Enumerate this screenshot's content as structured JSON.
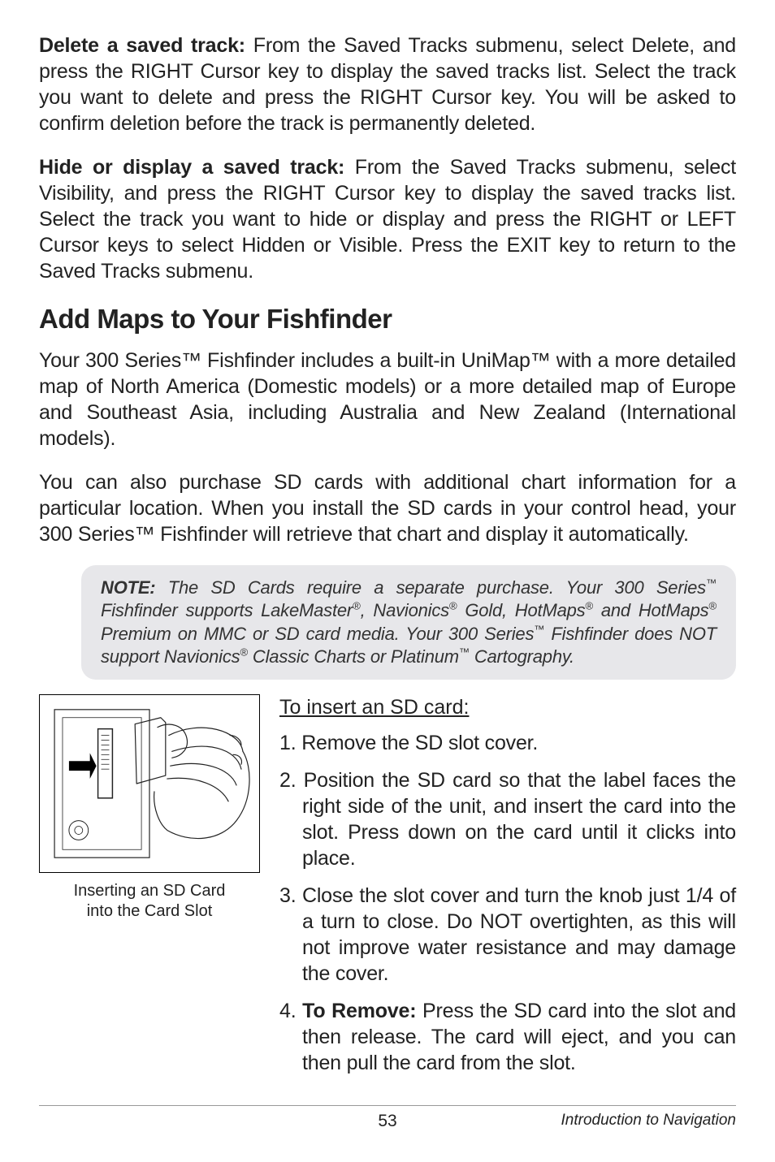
{
  "para1_label": "Delete a saved track:",
  "para1_text": " From the Saved Tracks submenu, select Delete, and press the RIGHT Cursor key to display the saved tracks list. Select the track you want to delete and press the RIGHT Cursor key. You will be asked to confirm deletion before the track is permanently deleted.",
  "para2_label": "Hide or display a saved track:",
  "para2_text": " From the Saved Tracks submenu, select Visibility, and press the RIGHT Cursor key to display the saved tracks list. Select the track you want to hide or display and press the RIGHT or LEFT Cursor keys to select Hidden or Visible. Press the EXIT key to return to the Saved Tracks submenu.",
  "heading": "Add Maps to Your Fishfinder",
  "para3": "Your 300 Series™ Fishfinder includes a built-in UniMap™ with a more detailed map of North America (Domestic models) or a more detailed map of Europe and Southeast Asia, including Australia and New Zealand (International models).",
  "para4": "You can also purchase SD cards with additional chart information for a particular location. When you install the SD cards in your control head, your 300 Series™ Fishfinder will retrieve that chart and display it automatically.",
  "note_label": "NOTE:",
  "note_text_1": " The SD Cards require a separate purchase. Your 300 Series",
  "note_sup_1": "™",
  "note_text_2": " Fishfinder supports LakeMaster",
  "note_sup_2": "®",
  "note_text_3": ", Navionics",
  "note_sup_3": "®",
  "note_text_4": " Gold, HotMaps",
  "note_sup_4": "®",
  "note_text_5": " and HotMaps",
  "note_sup_5": "®",
  "note_text_6": " Premium on MMC or SD card media. Your 300 Series",
  "note_sup_6": "™",
  "note_text_7": " Fishfinder does NOT support Navionics",
  "note_sup_7": "®",
  "note_text_8": " Classic Charts or Platinum",
  "note_sup_8": "™",
  "note_text_9": " Cartography.",
  "caption_line1": "Inserting an SD Card",
  "caption_line2": "into the Card Slot",
  "subheading": "To insert an SD card:",
  "steps": {
    "n1": "1. ",
    "s1": "Remove the SD slot cover.",
    "n2": "2. ",
    "s2": "Position the SD card so that the label faces the right side of the unit, and insert the card into the slot. Press down on the card until it clicks into place.",
    "n3": "3. ",
    "s3": "Close the slot cover and turn the knob just 1/4 of a turn to close. Do NOT overtighten, as this will not improve water resistance and may damage the cover.",
    "n4": "4. ",
    "s4_label": "To Remove:",
    "s4": " Press the SD card into the slot and then release. The card will eject, and you can then pull the card from the slot."
  },
  "page_num": "53",
  "footer_right": "Introduction to Navigation"
}
